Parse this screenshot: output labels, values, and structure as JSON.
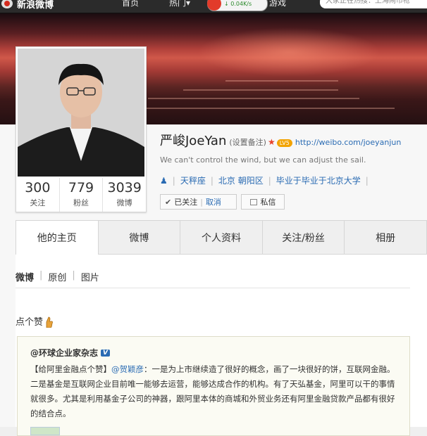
{
  "topbar": {
    "logo": "新浪微博",
    "nav": [
      "首页",
      "热门▾",
      "游戏"
    ],
    "speed": "0.04K/s",
    "search_placeholder": "大家正在热搜：上海闹市枪"
  },
  "profile": {
    "name": "严峻JoeYan",
    "remark": "(设置备注)",
    "level": "LV5",
    "url": "http://weibo.com/joeyanjun",
    "motto": "We can't control the wind, but we can adjust the sail.",
    "tags": [
      "天秤座",
      "北京 朝阳区",
      "毕业于北京大学"
    ],
    "stats": [
      {
        "num": "300",
        "label": "关注"
      },
      {
        "num": "779",
        "label": "粉丝"
      },
      {
        "num": "3039",
        "label": "微博"
      }
    ],
    "follow_label": "已关注",
    "cancel_label": "取消",
    "message_label": "私信"
  },
  "tabs": [
    "他的主页",
    "微博",
    "个人资料",
    "关注/粉丝",
    "相册"
  ],
  "subnav": [
    "微博",
    "原创",
    "图片"
  ],
  "feed": {
    "section_title": "点个赞",
    "post": {
      "author": "@环球企业家杂志",
      "badge": "V",
      "text_prefix": "【给阿里金融点个赞】",
      "mention": "@贺颖彦",
      "text": "：一是为上市继续造了很好的概念，画了一块很好的饼，互联网金融。二是基金是互联网企业目前唯一能够去运营，能够达成合作的机构。有了天弘基金，阿里可以干的事情就很多。尤其是利用基金子公司的神器，跟阿里本体的商城和外贸业务还有阿里金融贷款产品都有很好的结合点。"
    }
  }
}
